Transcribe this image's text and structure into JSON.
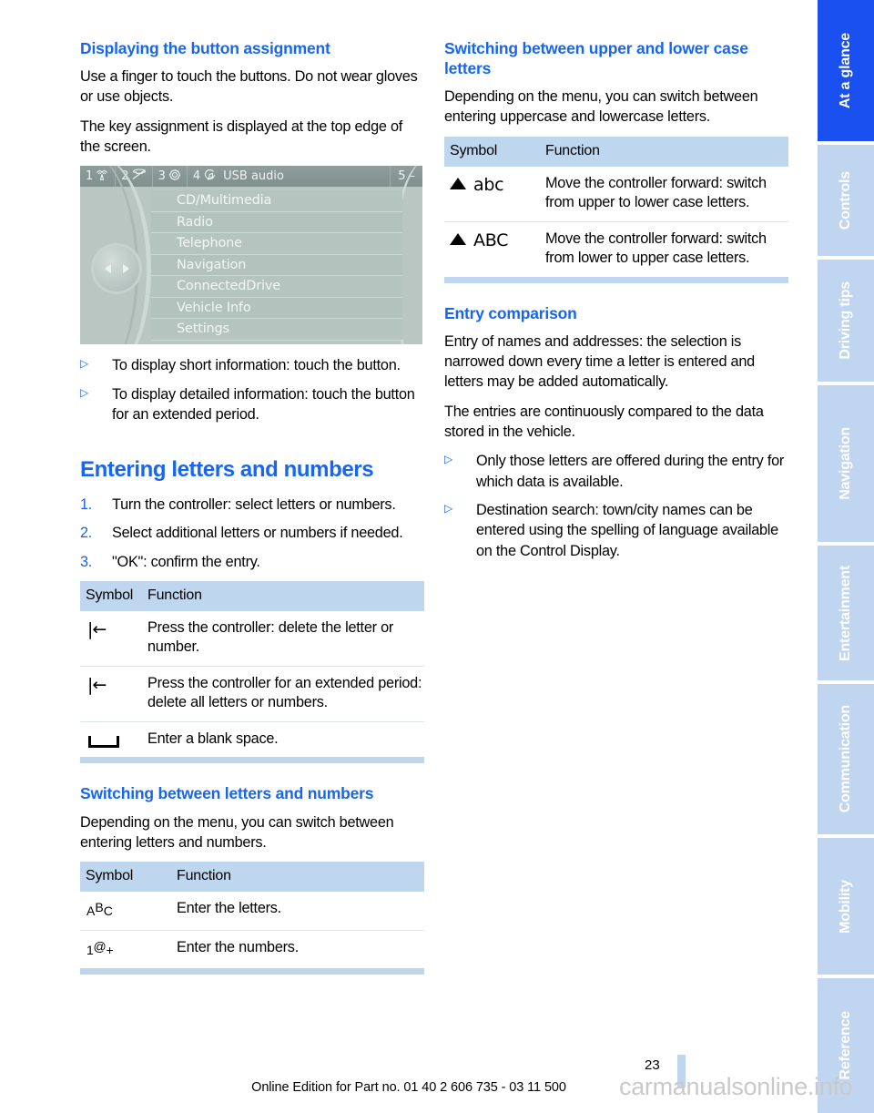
{
  "document": {
    "page_number": "23",
    "edition_line": "Online Edition for Part no. 01 40 2 606 735 - 03 11 500",
    "watermark": "carmanualsonline.info"
  },
  "colors": {
    "heading_blue": "#1765f0",
    "table_header_blue": "#bed7ef",
    "active_tab_blue": "#1a4ff0",
    "inactive_tab_blue": "#c0d6f0"
  },
  "left_column": {
    "section1": {
      "heading": "Displaying the button assignment",
      "paragraphs": [
        "Use a finger to touch the buttons. Do not wear gloves or use objects.",
        "The key assignment is displayed at the top edge of the screen."
      ],
      "bullets": [
        "To display short information: touch the button.",
        "To display detailed information: touch the button for an extended period."
      ]
    },
    "idrive_figure": {
      "status_bar": {
        "items": [
          {
            "number": "1",
            "icon": "radio-waves-icon"
          },
          {
            "number": "2",
            "icon": "telephone-handset-icon"
          },
          {
            "number": "3",
            "icon": "gear-icon"
          },
          {
            "number": "4",
            "icon": "media-note-icon",
            "label": "USB audio"
          }
        ],
        "right": {
          "number": "5",
          "label": "–"
        }
      },
      "menu_items": [
        "CD/Multimedia",
        "Radio",
        "Telephone",
        "Navigation",
        "ConnectedDrive",
        "Vehicle Info",
        "Settings"
      ]
    },
    "section2": {
      "heading": "Entering letters and numbers",
      "steps": [
        {
          "marker": "1.",
          "text": "Turn the controller: select letters or numbers."
        },
        {
          "marker": "2.",
          "text": "Select additional letters or numbers if needed."
        },
        {
          "marker": "3.",
          "text": "\"OK\": confirm the entry."
        }
      ],
      "table": {
        "columns": [
          "Symbol",
          "Function"
        ],
        "rows": [
          {
            "symbol": "|←",
            "symbol_name": "delete-letter-icon",
            "function": "Press the controller: delete the letter or number."
          },
          {
            "symbol": "|←",
            "symbol_name": "delete-all-icon",
            "function": "Press the controller for an extended period: delete all letters or numbers."
          },
          {
            "symbol": "␣",
            "symbol_name": "blank-space-icon",
            "function": "Enter a blank space."
          }
        ]
      }
    },
    "section3": {
      "heading": "Switching between letters and numbers",
      "paragraph": "Depending on the menu, you can switch between entering letters and numbers.",
      "table": {
        "columns": [
          "Symbol",
          "Function"
        ],
        "rows": [
          {
            "symbol": "ABC",
            "symbol_name": "letters-mode-icon",
            "function": "Enter the letters."
          },
          {
            "symbol": "1@+",
            "symbol_name": "numbers-mode-icon",
            "function": "Enter the numbers."
          }
        ]
      }
    }
  },
  "right_column": {
    "section1": {
      "heading": "Switching between upper and lower case letters",
      "paragraph": "Depending on the menu, you can switch between entering uppercase and lowercase letters.",
      "table": {
        "columns": [
          "Symbol",
          "Function"
        ],
        "rows": [
          {
            "symbol": "abc",
            "symbol_name": "triangle-lowercase-icon",
            "function": "Move the controller forward: switch from upper to lower case letters."
          },
          {
            "symbol": "ABC",
            "symbol_name": "triangle-uppercase-icon",
            "function": "Move the controller forward: switch from lower to upper case letters."
          }
        ]
      }
    },
    "section2": {
      "heading": "Entry comparison",
      "paragraphs": [
        "Entry of names and addresses: the selection is narrowed down every time a letter is entered and letters may be added automatically.",
        "The entries are continuously compared to the data stored in the vehicle."
      ],
      "bullets": [
        "Only those letters are offered during the entry for which data is available.",
        "Destination search: town/city names can be entered using the spelling of language available on the Control Display."
      ]
    }
  },
  "side_tabs": [
    {
      "label": "At a glance",
      "active": true
    },
    {
      "label": "Controls",
      "active": false
    },
    {
      "label": "Driving tips",
      "active": false
    },
    {
      "label": "Navigation",
      "active": false
    },
    {
      "label": "Entertainment",
      "active": false
    },
    {
      "label": "Communication",
      "active": false
    },
    {
      "label": "Mobility",
      "active": false
    },
    {
      "label": "Reference",
      "active": false
    }
  ]
}
